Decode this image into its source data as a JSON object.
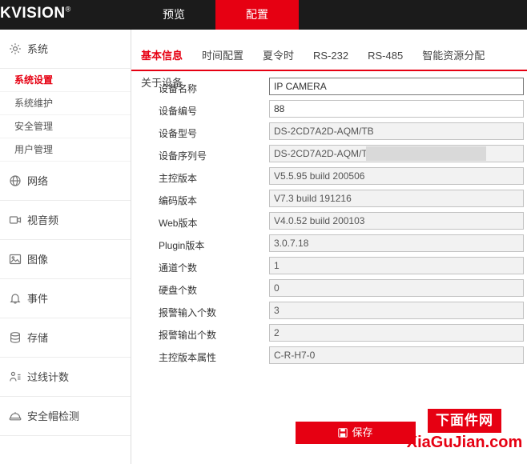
{
  "topbar": {
    "logo": "KVISION",
    "logo_mark": "®",
    "nav": [
      {
        "label": "预览",
        "active": false
      },
      {
        "label": "配置",
        "active": true
      }
    ]
  },
  "sidebar": {
    "items": [
      {
        "label": "系统",
        "icon": "gear-icon",
        "type": "group",
        "active": false
      },
      {
        "label": "系统设置",
        "icon": "none",
        "type": "sub",
        "active": true
      },
      {
        "label": "系统维护",
        "icon": "none",
        "type": "sub",
        "active": false
      },
      {
        "label": "安全管理",
        "icon": "none",
        "type": "sub",
        "active": false
      },
      {
        "label": "用户管理",
        "icon": "none",
        "type": "sub",
        "active": false
      },
      {
        "label": "网络",
        "icon": "globe-icon",
        "type": "group",
        "active": false
      },
      {
        "label": "视音频",
        "icon": "video-icon",
        "type": "group",
        "active": false
      },
      {
        "label": "图像",
        "icon": "image-icon",
        "type": "group",
        "active": false
      },
      {
        "label": "事件",
        "icon": "bell-icon",
        "type": "group",
        "active": false
      },
      {
        "label": "存储",
        "icon": "database-icon",
        "type": "group",
        "active": false
      },
      {
        "label": "过线计数",
        "icon": "counter-icon",
        "type": "group",
        "active": false
      },
      {
        "label": "安全帽检测",
        "icon": "helmet-icon",
        "type": "group",
        "active": false
      }
    ]
  },
  "tabs": [
    {
      "label": "基本信息",
      "active": true
    },
    {
      "label": "时间配置",
      "active": false
    },
    {
      "label": "夏令时",
      "active": false
    },
    {
      "label": "RS-232",
      "active": false
    },
    {
      "label": "RS-485",
      "active": false
    },
    {
      "label": "智能资源分配",
      "active": false
    },
    {
      "label": "关于设备",
      "active": false
    }
  ],
  "form": {
    "fields": [
      {
        "label": "设备名称",
        "value": "IP CAMERA",
        "readonly": false,
        "focus": true,
        "masked": false
      },
      {
        "label": "设备编号",
        "value": "88",
        "readonly": false,
        "focus": false,
        "masked": false
      },
      {
        "label": "设备型号",
        "value": "DS-2CD7A2D-AQM/TB",
        "readonly": true,
        "focus": false,
        "masked": false
      },
      {
        "label": "设备序列号",
        "value": "DS-2CD7A2D-AQM/TB",
        "readonly": true,
        "focus": false,
        "masked": true
      },
      {
        "label": "主控版本",
        "value": "V5.5.95 build 200506",
        "readonly": true,
        "focus": false,
        "masked": false
      },
      {
        "label": "编码版本",
        "value": "V7.3 build 191216",
        "readonly": true,
        "focus": false,
        "masked": false
      },
      {
        "label": "Web版本",
        "value": "V4.0.52 build 200103",
        "readonly": true,
        "focus": false,
        "masked": false
      },
      {
        "label": "Plugin版本",
        "value": "3.0.7.18",
        "readonly": true,
        "focus": false,
        "masked": false
      },
      {
        "label": "通道个数",
        "value": "1",
        "readonly": true,
        "focus": false,
        "masked": false
      },
      {
        "label": "硬盘个数",
        "value": "0",
        "readonly": true,
        "focus": false,
        "masked": false
      },
      {
        "label": "报警输入个数",
        "value": "3",
        "readonly": true,
        "focus": false,
        "masked": false
      },
      {
        "label": "报警输出个数",
        "value": "2",
        "readonly": true,
        "focus": false,
        "masked": false
      },
      {
        "label": "主控版本属性",
        "value": "C-R-H7-0",
        "readonly": true,
        "focus": false,
        "masked": false
      }
    ],
    "save_label": "保存"
  },
  "watermark": {
    "box_text": "下面件网",
    "site_text": "XiaGuJian.com"
  },
  "colors": {
    "accent": "#e60012",
    "topbar": "#1b1b1b",
    "readonly_bg": "#f2f2f2"
  }
}
